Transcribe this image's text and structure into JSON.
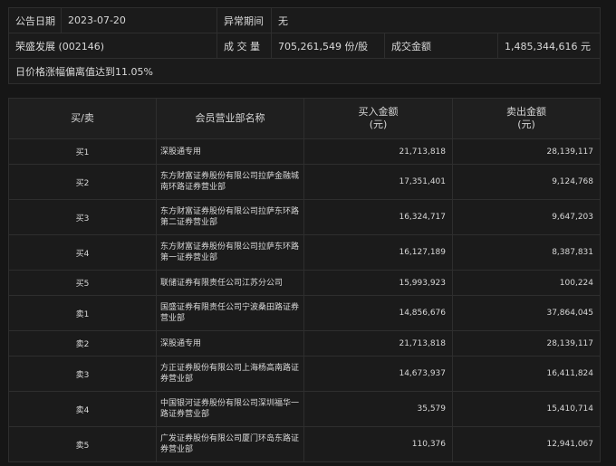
{
  "info": {
    "announce_label": "公告日期",
    "announce_date": "2023-07-20",
    "abnormal_label": "异常期间",
    "abnormal_value": "无",
    "stock": "荣盛发展 (002146)",
    "volume_label": "成 交 量",
    "volume_value": "705,261,549 份/股",
    "amount_label": "成交金额",
    "amount_value": "1,485,344,616 元",
    "reason": "日价格涨幅偏离值达到11.05%"
  },
  "table": {
    "headers": {
      "side": "买/卖",
      "broker": "会员营业部名称",
      "buy_line1": "买入金额",
      "buy_line2": "(元)",
      "sell_line1": "卖出金额",
      "sell_line2": "(元)"
    },
    "rows": [
      {
        "side": "买1",
        "broker": "深股通专用",
        "buy": "21,713,818",
        "sell": "28,139,117"
      },
      {
        "side": "买2",
        "broker": "东方财富证券股份有限公司拉萨金融城南环路证券营业部",
        "buy": "17,351,401",
        "sell": "9,124,768"
      },
      {
        "side": "买3",
        "broker": "东方财富证券股份有限公司拉萨东环路第二证券营业部",
        "buy": "16,324,717",
        "sell": "9,647,203"
      },
      {
        "side": "买4",
        "broker": "东方财富证券股份有限公司拉萨东环路第一证券营业部",
        "buy": "16,127,189",
        "sell": "8,387,831"
      },
      {
        "side": "买5",
        "broker": "联储证券有限责任公司江苏分公司",
        "buy": "15,993,923",
        "sell": "100,224"
      },
      {
        "side": "卖1",
        "broker": "国盛证券有限责任公司宁波桑田路证券营业部",
        "buy": "14,856,676",
        "sell": "37,864,045"
      },
      {
        "side": "卖2",
        "broker": "深股通专用",
        "buy": "21,713,818",
        "sell": "28,139,117"
      },
      {
        "side": "卖3",
        "broker": "方正证券股份有限公司上海杨高南路证券营业部",
        "buy": "14,673,937",
        "sell": "16,411,824"
      },
      {
        "side": "卖4",
        "broker": "中国银河证券股份有限公司深圳福华一路证券营业部",
        "buy": "35,579",
        "sell": "15,410,714"
      },
      {
        "side": "卖5",
        "broker": "广发证券股份有限公司厦门环岛东路证券营业部",
        "buy": "110,376",
        "sell": "12,941,067"
      }
    ]
  }
}
